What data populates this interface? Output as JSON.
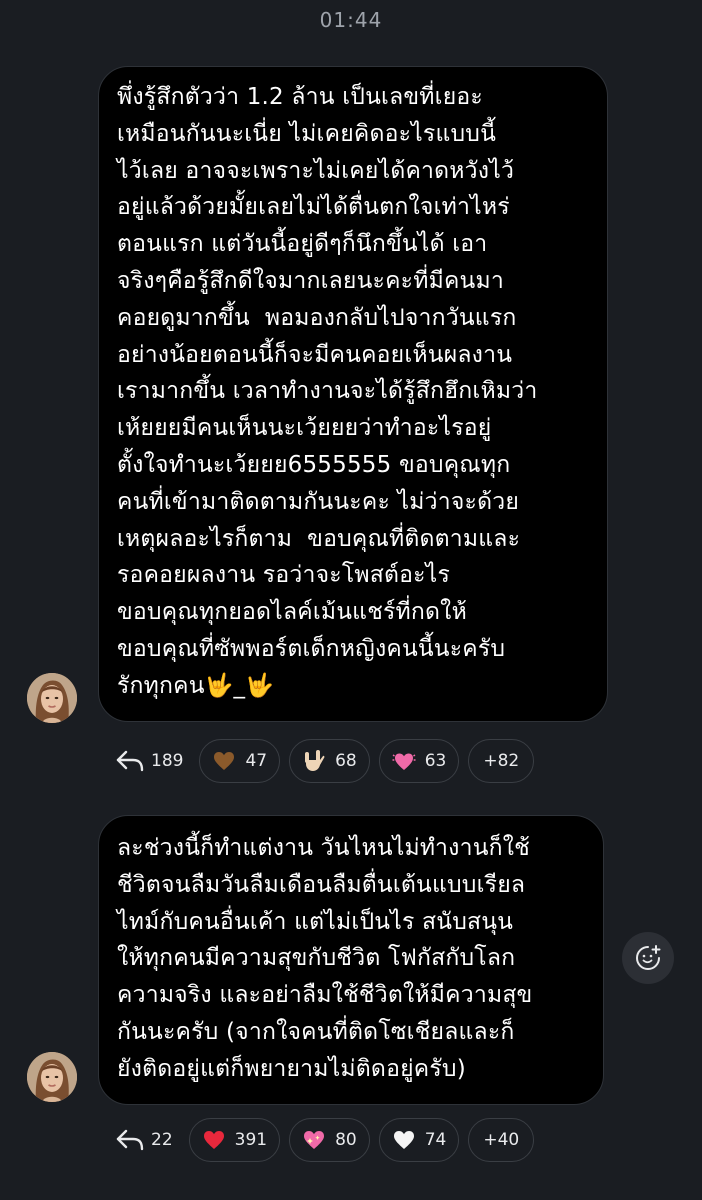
{
  "status_time": "01:44",
  "messages": [
    {
      "text": "พึ่งรู้สึกตัวว่า 1.2 ล้าน เป็นเลขที่เยอะ\nเหมือนกันนะเนี่ย ไม่เคยคิดอะไรแบบนี้\nไว้เลย อาจจะเพราะไม่เคยได้คาดหวังไว้\nอยู่แล้วด้วยมั้ยเลยไม่ได้ตื่นตกใจเท่าไหร่\nตอนแรก แต่วันนี้อยู่ดีๆก็นึกขึ้นได้ เอา\nจริงๆคือรู้สึกดีใจมากเลยนะคะที่มีคนมา\nคอยดูมากขึ้น  พอมองกลับไปจากวันแรก\nอย่างน้อยตอนนี้ก็จะมีคนคอยเห็นผลงาน\nเรามากขึ้น เวลาทำงานจะได้รู้สึกฮึกเหิมว่า\nเห้ยยยมีคนเห็นนะเว้ยยยว่าทำอะไรอยู่\nตั้งใจทำนะเว้ยยย6555555 ขอบคุณทุก\nคนที่เข้ามาติดตามกันนะคะ ไม่ว่าจะด้วย\nเหตุผลอะไรก็ตาม  ขอบคุณที่ติดตามและ\nรอคอยผลงาน รอว่าจะโพสต์อะไร\nขอบคุณทุกยอดไลค์เม้นแชร์ที่กดให้\nขอบคุณที่ซัพพอร์ตเด็กหญิงคนนี้นะครับ\nรักทุกคน🤟_🤟",
      "reply_count": "189",
      "reactions": [
        {
          "emoji": "brown-heart",
          "count": "47"
        },
        {
          "emoji": "love-you-gesture",
          "count": "68"
        },
        {
          "emoji": "beating-heart",
          "count": "63"
        }
      ],
      "more": "+82"
    },
    {
      "text": "ละช่วงนี้ก็ทำแต่งาน วันไหนไม่ทำงานก็ใช้\nชีวิตจนลืมวันลืมเดือนลืมตื่นเต้นแบบเรียล\nไทม์กับคนอื่นเค้า แต่ไม่เป็นไร สนับสนุน\nให้ทุกคนมีความสุขกับชีวิต โฟกัสกับโลก\nความจริง และอย่าลืมใช้ชีวิตให้มีความสุข\nกันนะครับ (จากใจคนที่ติดโซเชียลและก็\nยังติดอยู่แต่ก็พยายามไม่ติดอยู่ครับ)",
      "reply_count": "22",
      "reactions": [
        {
          "emoji": "red-heart",
          "count": "391"
        },
        {
          "emoji": "sparkling-heart",
          "count": "80"
        },
        {
          "emoji": "white-heart",
          "count": "74"
        }
      ],
      "more": "+40"
    }
  ],
  "icons": {
    "reply": "reply-arrow-icon",
    "add_reaction": "add-reaction-icon",
    "avatar": "user-avatar"
  }
}
